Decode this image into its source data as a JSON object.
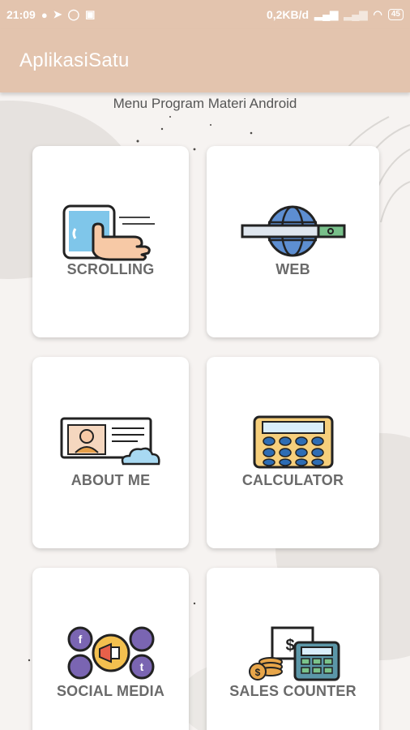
{
  "status_bar": {
    "time": "21:09",
    "network_speed": "0,2KB/d",
    "battery": "45",
    "left_icons": [
      "messenger-icon",
      "telegram-icon",
      "whatsapp-icon",
      "trash-icon"
    ],
    "right_icons": [
      "signal-icon",
      "signal-icon",
      "wifi-icon",
      "battery-icon"
    ]
  },
  "app_bar": {
    "title": "AplikasiSatu"
  },
  "subtitle": "Menu Program Materi Android",
  "menu": [
    {
      "label": "SCROLLING",
      "icon": "scrolling-phone-icon"
    },
    {
      "label": "WEB",
      "icon": "web-globe-icon"
    },
    {
      "label": "ABOUT ME",
      "icon": "id-card-icon"
    },
    {
      "label": "CALCULATOR",
      "icon": "calculator-icon"
    },
    {
      "label": "SOCIAL MEDIA",
      "icon": "social-media-icon"
    },
    {
      "label": "SALES COUNTER",
      "icon": "sales-counter-icon"
    }
  ],
  "colors": {
    "app_bar": "#e3c4ae",
    "background": "#f6f3f1",
    "label": "#6a6a6a"
  }
}
